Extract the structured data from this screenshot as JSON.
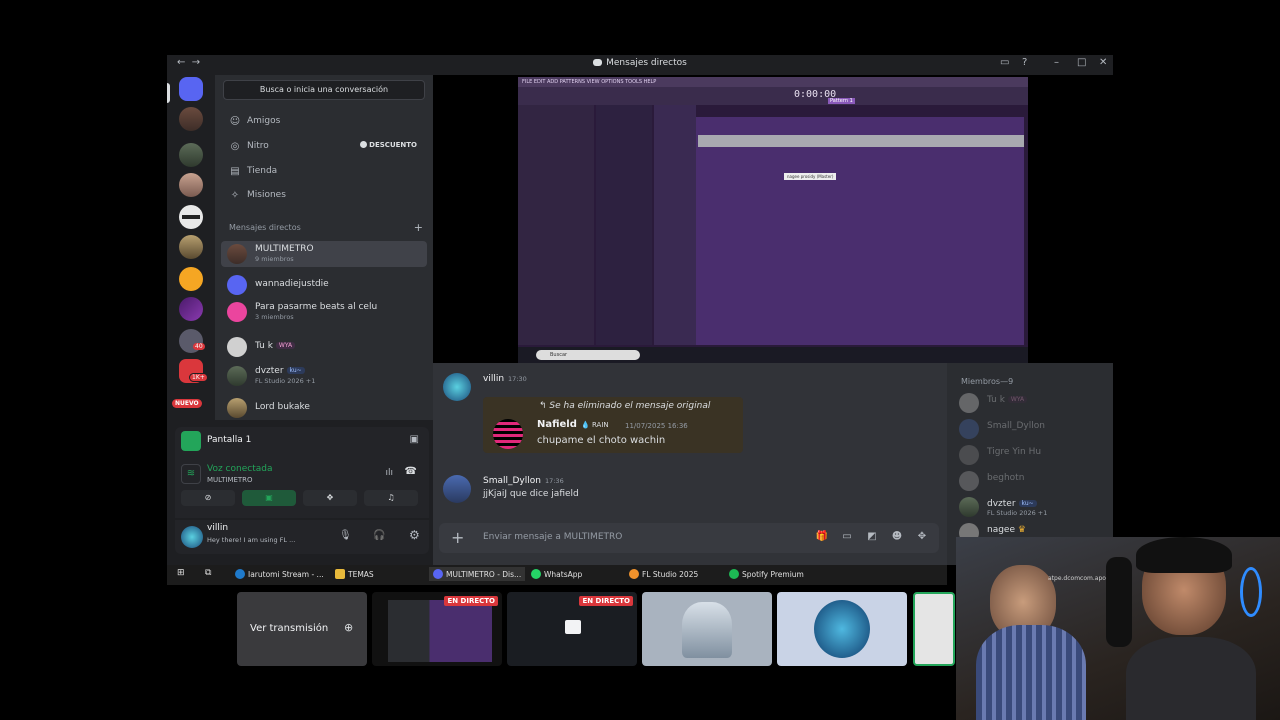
{
  "window": {
    "title": "Mensajes directos",
    "nav_back": "←",
    "nav_forward": "→"
  },
  "sidebar": {
    "search_placeholder": "Busca o inicia una conversación",
    "nav": [
      {
        "label": "Amigos",
        "icon": "friends-icon"
      },
      {
        "label": "Nitro",
        "icon": "nitro-icon",
        "badge": "DESCUENTO"
      },
      {
        "label": "Tienda",
        "icon": "shop-icon"
      },
      {
        "label": "Misiones",
        "icon": "quests-icon"
      }
    ],
    "dm_header": "Mensajes directos",
    "dms": [
      {
        "name": "MULTIMETRO",
        "sub": "9 miembros"
      },
      {
        "name": "wannadiejustdie",
        "sub": ""
      },
      {
        "name": "Para pasarme beats al celu",
        "sub": "3 miembros"
      },
      {
        "name": "Tu k",
        "tag": "WYA",
        "sub": ""
      },
      {
        "name": "dvzter",
        "tag": "ku~",
        "sub": "FL Studio 2026 +1"
      },
      {
        "name": "Lord bukake",
        "sub": ""
      }
    ],
    "rail_new_badge": "NUEVO",
    "rail_badges": [
      "40",
      "1K+"
    ]
  },
  "screenshare": {
    "title": "Pantalla 1"
  },
  "voice": {
    "status": "Voz conectada",
    "channel": "MULTIMETRO"
  },
  "user": {
    "name": "villin",
    "status": "Hey there! I am using FL ..."
  },
  "fl_studio": {
    "menu": "FILE EDIT ADD PATTERNS VIEW OPTIONS TOOLS HELP",
    "time": "0:00:00",
    "pattern": "Pattern 1",
    "search": "Buscar",
    "clip_label": "nagee prosidy (Master)"
  },
  "chat": {
    "messages": [
      {
        "author": "villin",
        "time": "17:30",
        "reply_deleted": "Se ha eliminado el mensaje original",
        "quoted_author": "Nafield",
        "quoted_tag": "RAIN",
        "quoted_time": "11/07/2025 16:36",
        "quoted_text": "chupame el choto wachin"
      },
      {
        "author": "Small_Dyllon",
        "time": "17:36",
        "text": "jjKjaiJ que dice jafield"
      }
    ],
    "composer_placeholder": "Enviar mensaje a MULTIMETRO"
  },
  "members": {
    "header": "Miembros—9",
    "list": [
      {
        "name": "Tu k",
        "tag": "WYA",
        "sub": "",
        "dim": true
      },
      {
        "name": "Small_Dyllon",
        "sub": "",
        "dim": true
      },
      {
        "name": "Tigre Yin Hu",
        "sub": "",
        "dim": true
      },
      {
        "name": "beghotn",
        "sub": "",
        "dim": true
      },
      {
        "name": "dvzter",
        "tag": "ku~",
        "sub": "FL Studio 2026 +1",
        "dim": false
      },
      {
        "name": "nagee",
        "sub": "",
        "dim": false
      }
    ]
  },
  "taskbar": {
    "items": [
      {
        "label": "Iarutomi Stream - ...",
        "color": "#1f7acb"
      },
      {
        "label": "TEMAS",
        "color": "#e8b93b"
      },
      {
        "label": "MULTIMETRO - Dis...",
        "color": "#5865f2"
      },
      {
        "label": "WhatsApp",
        "color": "#25d366"
      },
      {
        "label": "FL Studio 2025",
        "color": "#f0922c"
      },
      {
        "label": "Spotify Premium",
        "color": "#1db954"
      }
    ]
  },
  "streams": {
    "watch_label": "Ver transmisión",
    "live_label": "EN DIRECTO"
  },
  "webcam": {
    "overlay_text": "atpe.dcomcom.apo"
  },
  "colors": {
    "discord_blurple": "#5865f2",
    "voice_green": "#23a55a",
    "live_red": "#da373c"
  }
}
